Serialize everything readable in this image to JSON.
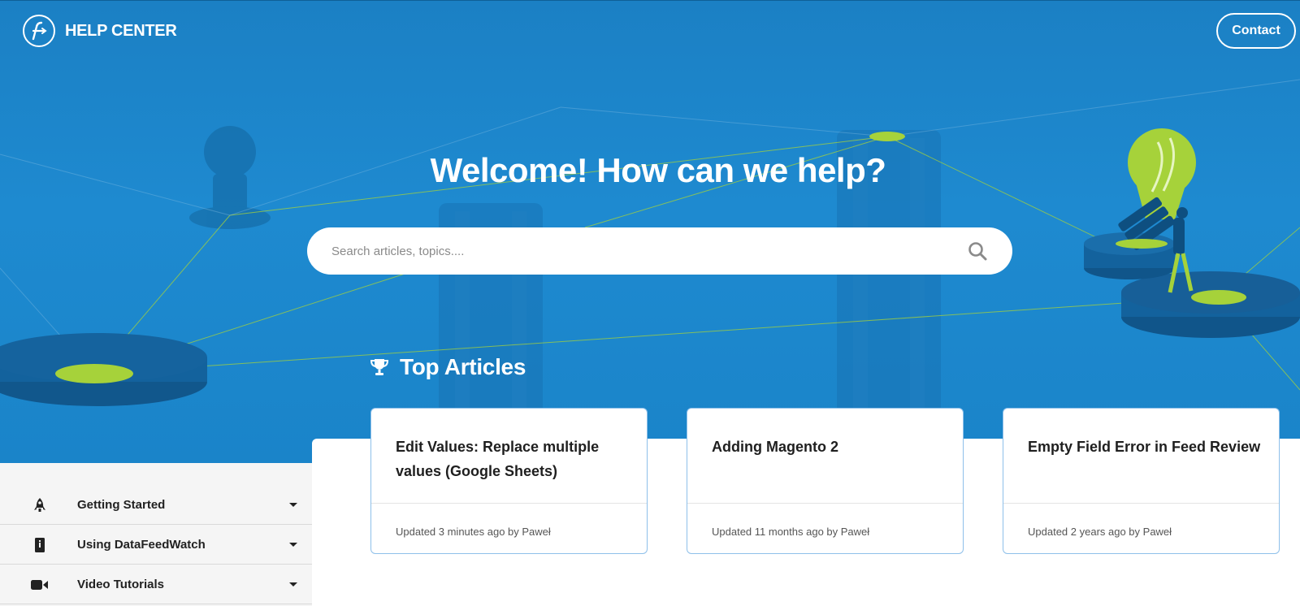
{
  "header": {
    "logo_text": "HELP CENTER",
    "contact_label": "Contact"
  },
  "hero": {
    "headline": "Welcome! How can we help?",
    "search": {
      "placeholder": "Search articles, topics...."
    }
  },
  "top_articles": {
    "heading": "Top Articles",
    "items": [
      {
        "title": "Edit Values: Replace multiple values (Google Sheets)",
        "meta": "Updated 3 minutes ago by Paweł"
      },
      {
        "title": "Adding Magento 2",
        "meta": "Updated 11 months ago by Paweł"
      },
      {
        "title": "Empty Field Error in Feed Review",
        "meta": "Updated 2 years ago by Paweł"
      }
    ]
  },
  "sidebar": {
    "items": [
      {
        "label": "Getting Started",
        "icon": "rocket-icon"
      },
      {
        "label": "Using DataFeedWatch",
        "icon": "book-icon"
      },
      {
        "label": "Video Tutorials",
        "icon": "video-camera-icon"
      }
    ]
  },
  "colors": {
    "hero_blue": "#1e8ad0",
    "accent_green": "#a6d23a",
    "card_border": "#8ec0ea"
  }
}
